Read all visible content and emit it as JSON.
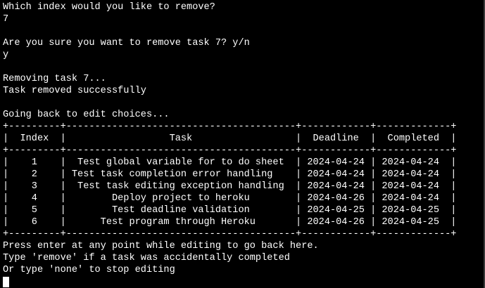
{
  "terminal": {
    "lines": [
      "Which index would you like to remove?",
      "7",
      "",
      "Are you sure you want to remove task 7? y/n",
      "y",
      "",
      "Removing task 7...",
      "Task removed successfully",
      "",
      "Going back to edit choices..."
    ],
    "table": {
      "border_top": "+---------+----------------------------------------+------------+-------------+",
      "header_row": "|  Index  |                  Task                  |  Deadline  |  Completed  |",
      "border_mid": "+---------+----------------------------------------+------------+-------------+",
      "rows": [
        "|    1    |  Test global variable for to do sheet  | 2024-04-24 | 2024-04-24  |",
        "|    2    | Test task completion error handling    | 2024-04-24 | 2024-04-24  |",
        "|    3    |  Test task editing exception handling  | 2024-04-24 | 2024-04-24  |",
        "|    4    |        Deploy project to heroku        | 2024-04-26 | 2024-04-24  |",
        "|    5    |        Test deadline validation        | 2024-04-25 | 2024-04-25  |",
        "|    6    |      Test program through Heroku       | 2024-04-26 | 2024-04-25  |"
      ],
      "border_bottom": "+---------+----------------------------------------+------------+-------------+"
    },
    "footer_lines": [
      "Press enter at any point while editing to go back here.",
      "Type 'remove' if a task was accidentally completed",
      "Or type 'none' to stop editing"
    ]
  }
}
